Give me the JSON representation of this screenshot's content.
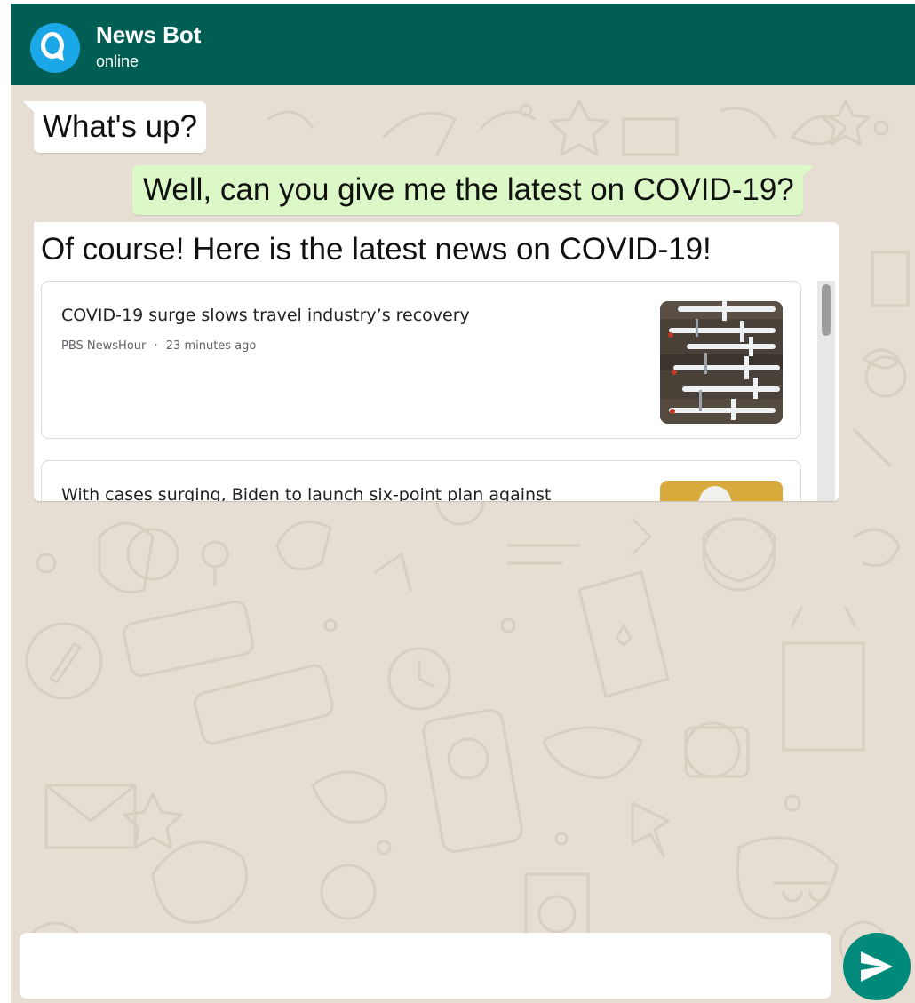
{
  "header": {
    "bot_name": "News Bot",
    "status": "online",
    "background_color": "#005e54",
    "avatar_icon": "alexa-ring-icon",
    "avatar_color": "#1aa8e8"
  },
  "messages": [
    {
      "sender": "bot",
      "text": "What's up?"
    },
    {
      "sender": "user",
      "text": "Well, can you give me the latest on COVID-19?"
    },
    {
      "sender": "bot",
      "text": "Of course! Here is the latest news on COVID-19!"
    }
  ],
  "news": [
    {
      "title": "COVID-19 surge slows travel industry’s recovery",
      "source": "PBS NewsHour",
      "separator": "·",
      "time": "23 minutes ago",
      "thumbnail": "parked-airplanes-image"
    },
    {
      "title": "With cases surging, Biden to launch six-point plan against",
      "thumbnail": "biden-portrait-image"
    }
  ],
  "composer": {
    "placeholder": "",
    "send_icon": "send-arrow-icon",
    "send_color": "#008a7c"
  },
  "theme": {
    "wallpaper_color": "#e6ddd3",
    "incoming_bubble": "#ffffff",
    "outgoing_bubble": "#dcf8c6"
  }
}
